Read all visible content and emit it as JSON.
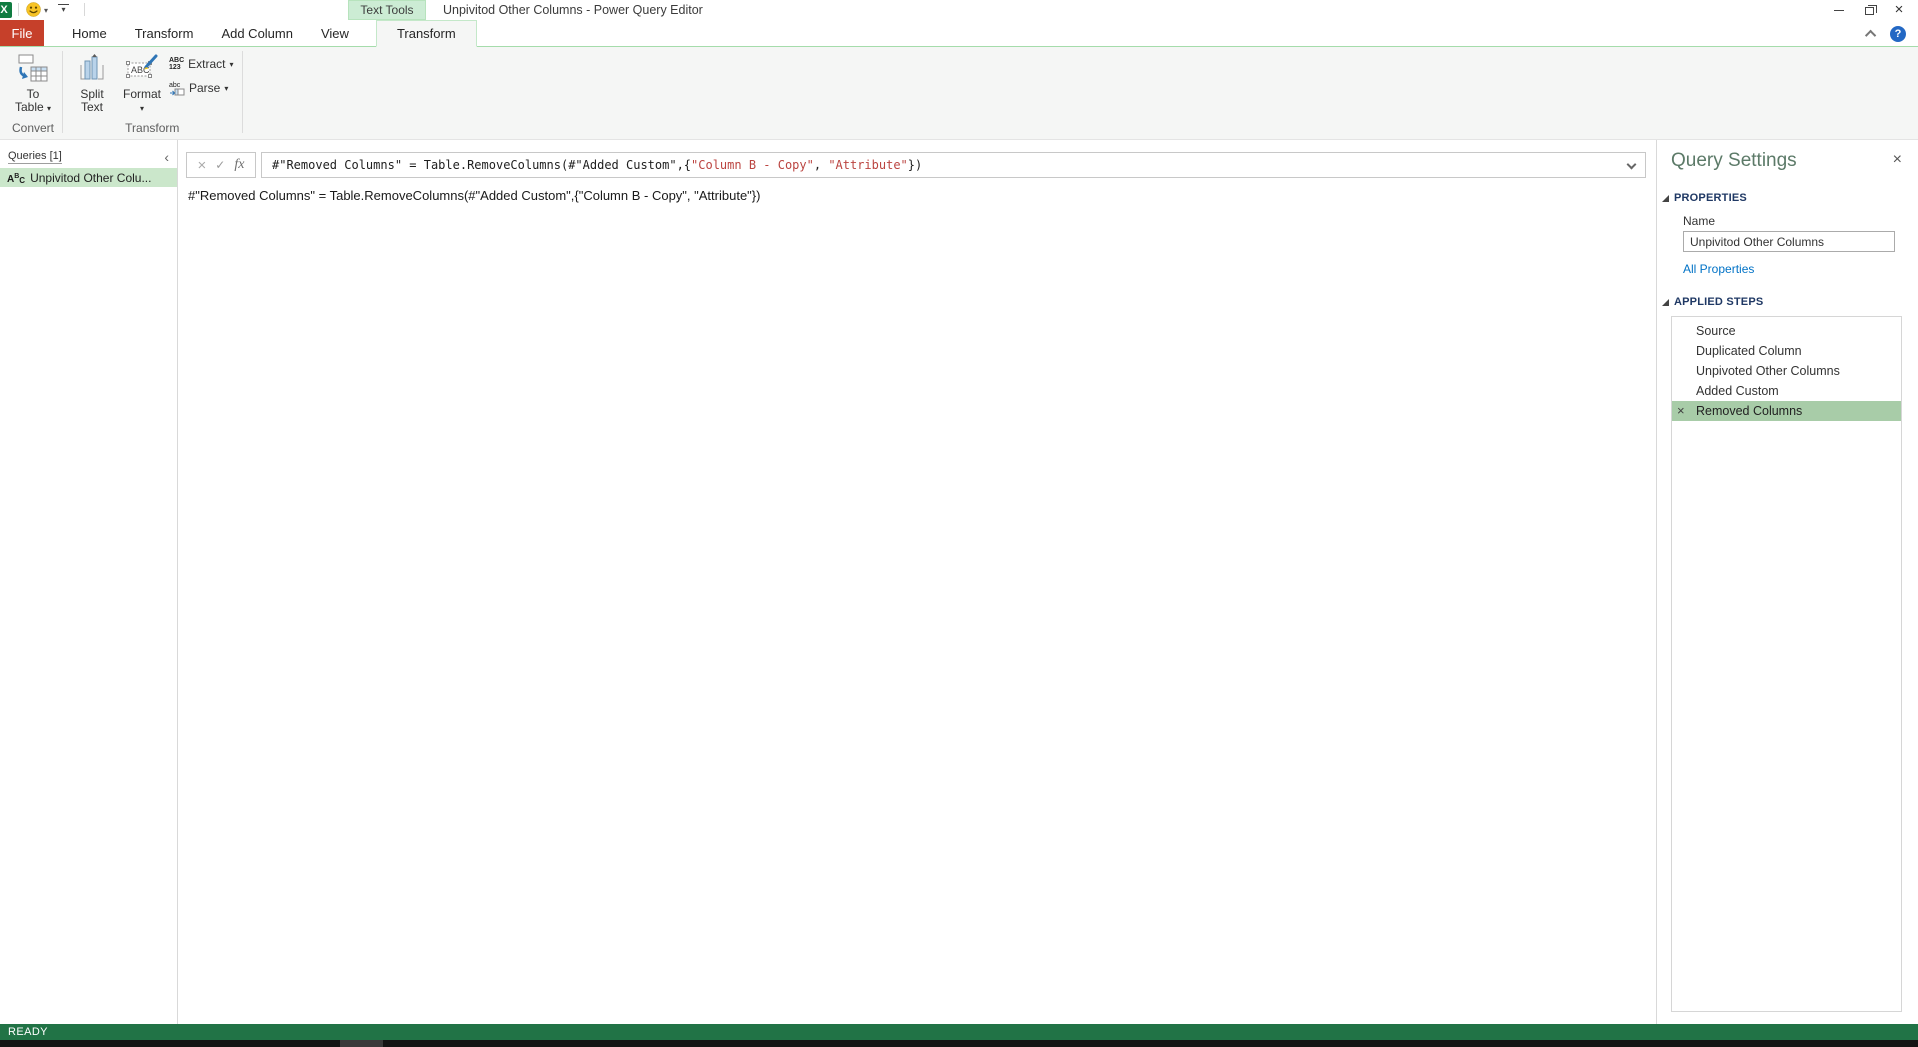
{
  "window": {
    "title": "Unpivitod Other Columns - Power Query Editor",
    "text_tools_label": "Text Tools"
  },
  "tabs": {
    "file": "File",
    "items": [
      "Home",
      "Transform",
      "Add Column",
      "View"
    ],
    "contextual": "Transform"
  },
  "ribbon": {
    "groups": [
      {
        "label": "Convert"
      },
      {
        "label": "Transform"
      }
    ],
    "buttons": {
      "to_table": {
        "line1": "To",
        "line2": "Table"
      },
      "split_text": {
        "line1": "Split",
        "line2": "Text"
      },
      "format": {
        "line1": "Format"
      },
      "extract": {
        "label": "Extract"
      },
      "parse": {
        "label": "Parse"
      }
    }
  },
  "queries_pane": {
    "header": "Queries [1]",
    "items": [
      {
        "label": "Unpivitod Other Colu...",
        "type": "text",
        "selected": true
      }
    ]
  },
  "formula_bar": {
    "fx_label": "fx",
    "code_prefix": "#\"Removed Columns\" = Table.RemoveColumns(#\"Added Custom\",{",
    "string_1": "\"Column B - Copy\"",
    "comma": ", ",
    "string_2": "\"Attribute\"",
    "code_suffix": "})"
  },
  "document": {
    "code_line": "#\"Removed Columns\" = Table.RemoveColumns(#\"Added Custom\",{\"Column B - Copy\", \"Attribute\"})"
  },
  "query_settings": {
    "title": "Query Settings",
    "properties_label": "PROPERTIES",
    "name_label": "Name",
    "name_value": "Unpivitod Other Columns",
    "all_properties_label": "All Properties",
    "applied_steps_label": "APPLIED STEPS",
    "steps": [
      {
        "label": "Source",
        "selected": false
      },
      {
        "label": "Duplicated Column",
        "selected": false
      },
      {
        "label": "Unpivoted Other Columns",
        "selected": false
      },
      {
        "label": "Added Custom",
        "selected": false
      },
      {
        "label": "Removed Columns",
        "selected": true
      }
    ]
  },
  "status_bar": {
    "label": "READY"
  },
  "colors": {
    "status_green": "#217346",
    "file_tab_red": "#c6402a",
    "contextual_tab_green": "#ccecd4",
    "step_selection_green": "#a8cca8",
    "query_selection_green": "#cbe7cb",
    "string_literal_red": "#bb4440",
    "link_blue": "#0072c6",
    "section_header_navy": "#1f3864",
    "excel_logo_green": "#107c41"
  }
}
